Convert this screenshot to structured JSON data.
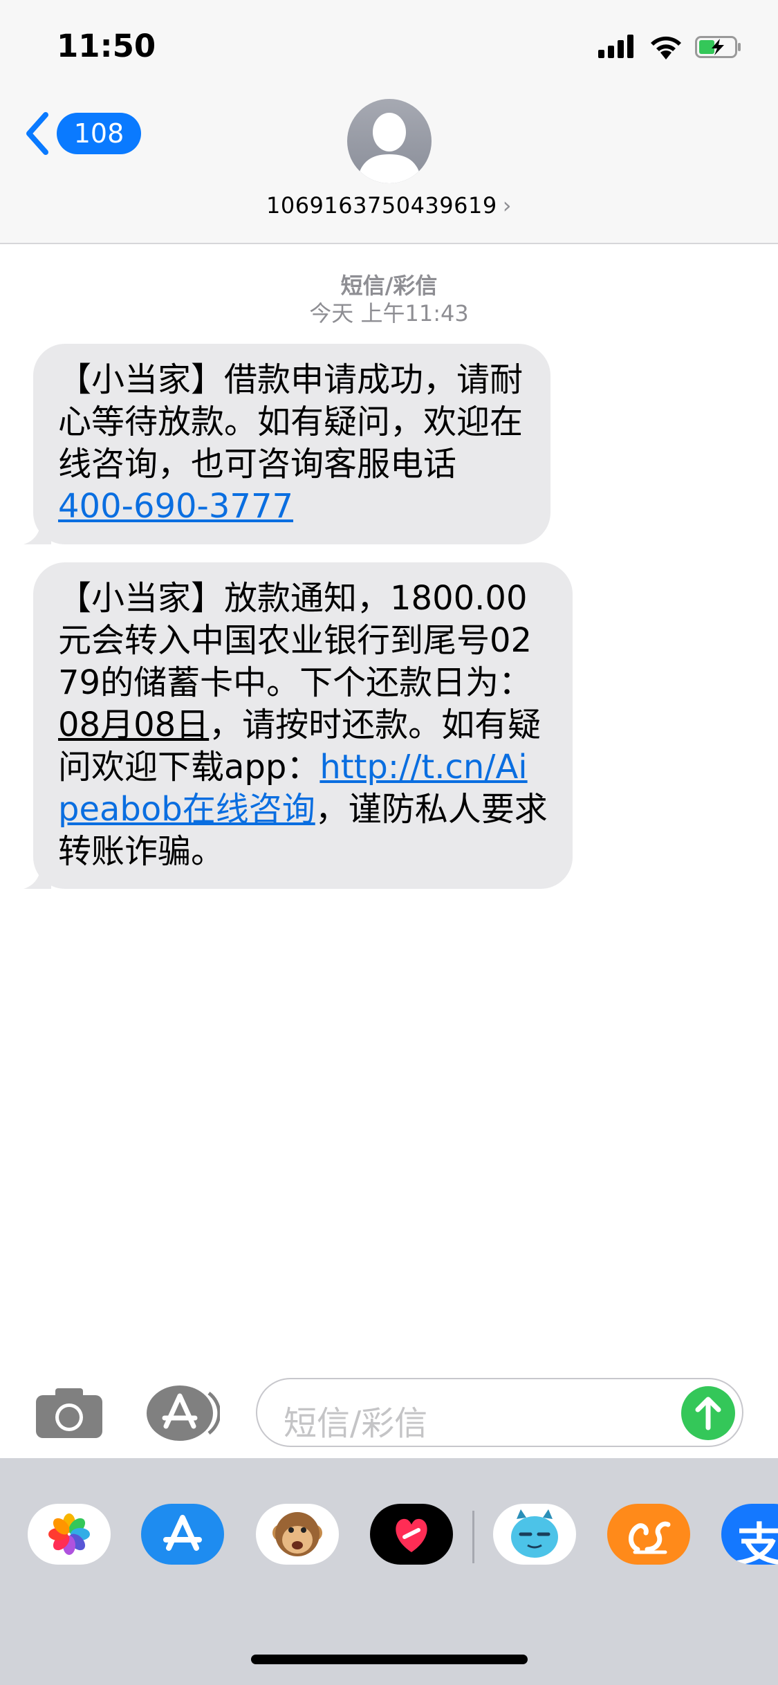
{
  "status_bar": {
    "time": "11:50"
  },
  "header": {
    "back_count": "108",
    "contact_number": "1069163750439619",
    "contact_chevron": "›"
  },
  "conversation": {
    "service_label": "短信/彩信",
    "timestamp": "今天 上午11:43"
  },
  "messages": [
    {
      "pre": "【小当家】借款申请成功，请耐心等待放款。如有疑问，欢迎在线咨询，也可咨询客服电话",
      "link": "400-690-3777"
    },
    {
      "pre": "【小当家】放款通知，1800.00元会转入中国农业银行到尾号0279的储蓄卡中。下个还款日为：",
      "date": "08月08日",
      "mid": "，请按时还款。如有疑问欢迎下载app：",
      "link": "http://t.cn/Aipeabob在线咨询",
      "post": "，谨防私人要求转账诈骗。"
    }
  ],
  "composer": {
    "placeholder": "短信/彩信"
  },
  "app_drawer": {
    "apps": [
      "photos-icon",
      "app-store-icon",
      "animoji-icon",
      "digital-touch-icon",
      "sticker-app-icon",
      "uc-browser-icon",
      "alipay-icon"
    ],
    "alipay_glyph": "支"
  },
  "colors": {
    "accent": "#0a7aff",
    "bubble": "#e9e9eb",
    "send": "#34c759",
    "link": "#0a6ee0"
  }
}
